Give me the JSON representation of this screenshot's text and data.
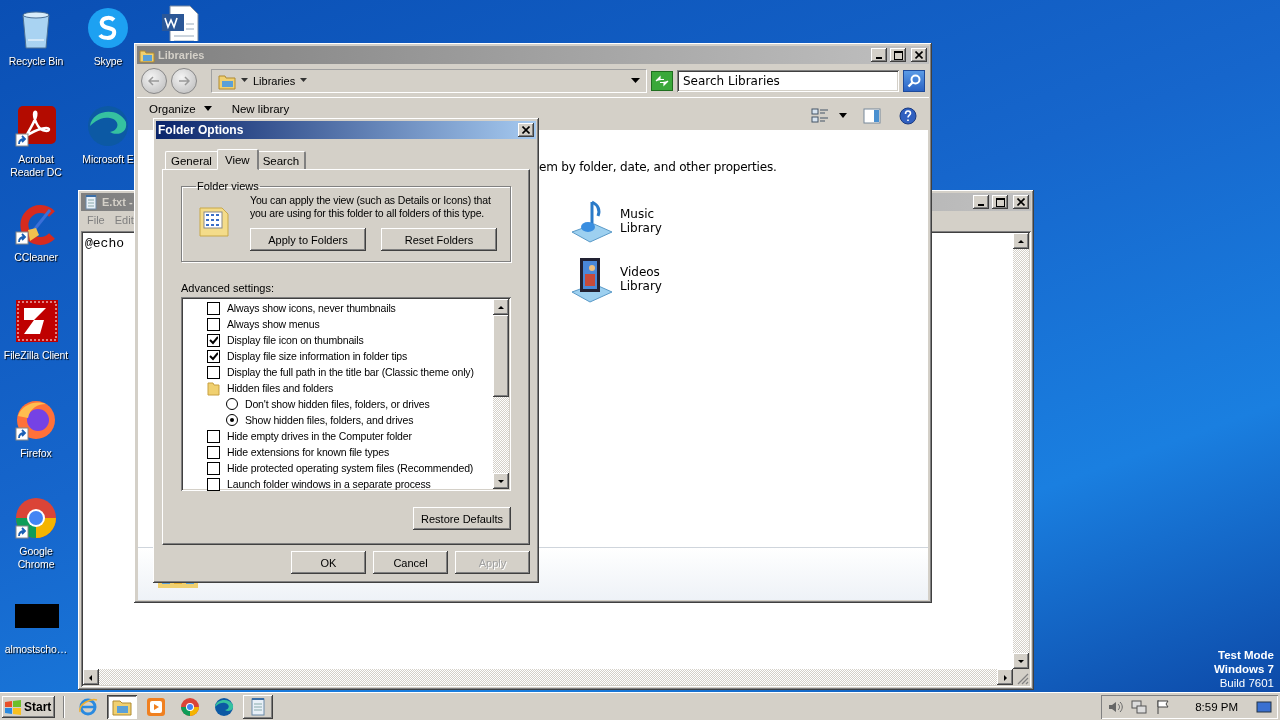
{
  "desktop": {
    "icons": [
      {
        "kind": "recycle",
        "label": "Recycle Bin"
      },
      {
        "kind": "acrobat",
        "label": "Acrobat Reader DC"
      },
      {
        "kind": "ccleaner",
        "label": "CCleaner"
      },
      {
        "kind": "filezilla",
        "label": "FileZilla Client"
      },
      {
        "kind": "firefox",
        "label": "Firefox"
      },
      {
        "kind": "chrome",
        "label": "Google Chrome"
      },
      {
        "kind": "blank",
        "label": "almostscho…"
      },
      {
        "kind": "skype",
        "label": "Skype"
      },
      {
        "kind": "edge",
        "label": "Microsoft E"
      }
    ],
    "test_mode": [
      "Test Mode",
      "Windows 7",
      "Build 7601"
    ]
  },
  "notepad": {
    "title": "E.txt -",
    "menu": [
      "File",
      "Edit"
    ],
    "text": "@echo"
  },
  "libraries": {
    "title": "Libraries",
    "address": "Libraries",
    "search": {
      "placeholder": "Search Libraries"
    },
    "toolbar": [
      {
        "label": "Organize",
        "menu": true
      },
      {
        "label": "New library",
        "menu": false
      }
    ],
    "description": "em by folder, date, and other properties.",
    "items": [
      {
        "kind": "music",
        "label": "Music Library"
      },
      {
        "kind": "videos",
        "label": "Videos Library"
      }
    ]
  },
  "folder_options": {
    "title": "Folder Options",
    "tabs": [
      {
        "label": "General",
        "selected": false
      },
      {
        "label": "View",
        "selected": true
      },
      {
        "label": "Search",
        "selected": false
      }
    ],
    "folder_views": {
      "legend": "Folder views",
      "description": "You can apply the view (such as Details or Icons) that you are using for this folder to all folders of this type.",
      "buttons": [
        "Apply to Folders",
        "Reset Folders"
      ]
    },
    "advanced_label": "Advanced settings:",
    "advanced_settings": [
      {
        "kind": "checkbox",
        "label": "Always show icons, never thumbnails",
        "checked": false
      },
      {
        "kind": "checkbox",
        "label": "Always show menus",
        "checked": false
      },
      {
        "kind": "checkbox",
        "label": "Display file icon on thumbnails",
        "checked": true
      },
      {
        "kind": "checkbox",
        "label": "Display file size information in folder tips",
        "checked": true
      },
      {
        "kind": "checkbox",
        "label": "Display the full path in the title bar (Classic theme only)",
        "checked": false
      },
      {
        "kind": "group",
        "label": "Hidden files and folders",
        "children": [
          {
            "kind": "radio",
            "label": "Don't show hidden files, folders, or drives",
            "selected": false
          },
          {
            "kind": "radio",
            "label": "Show hidden files, folders, and drives",
            "selected": true
          }
        ]
      },
      {
        "kind": "checkbox",
        "label": "Hide empty drives in the Computer folder",
        "checked": false
      },
      {
        "kind": "checkbox",
        "label": "Hide extensions for known file types",
        "checked": false
      },
      {
        "kind": "checkbox",
        "label": "Hide protected operating system files (Recommended)",
        "checked": false
      },
      {
        "kind": "checkbox",
        "label": "Launch folder windows in a separate process",
        "checked": false
      }
    ],
    "restore_button": "Restore Defaults",
    "buttons": [
      {
        "label": "OK",
        "disabled": false
      },
      {
        "label": "Cancel",
        "disabled": false
      },
      {
        "label": "Apply",
        "disabled": true
      }
    ]
  },
  "taskbar": {
    "start": "Start",
    "buttons": [
      {
        "kind": "ie",
        "selected": false
      },
      {
        "kind": "explorer",
        "selected": true
      },
      {
        "kind": "media",
        "selected": false
      },
      {
        "kind": "chrome",
        "selected": false
      },
      {
        "kind": "edge",
        "selected": false
      },
      {
        "kind": "notepad",
        "selected": false
      }
    ],
    "clock": "8:59 PM"
  }
}
